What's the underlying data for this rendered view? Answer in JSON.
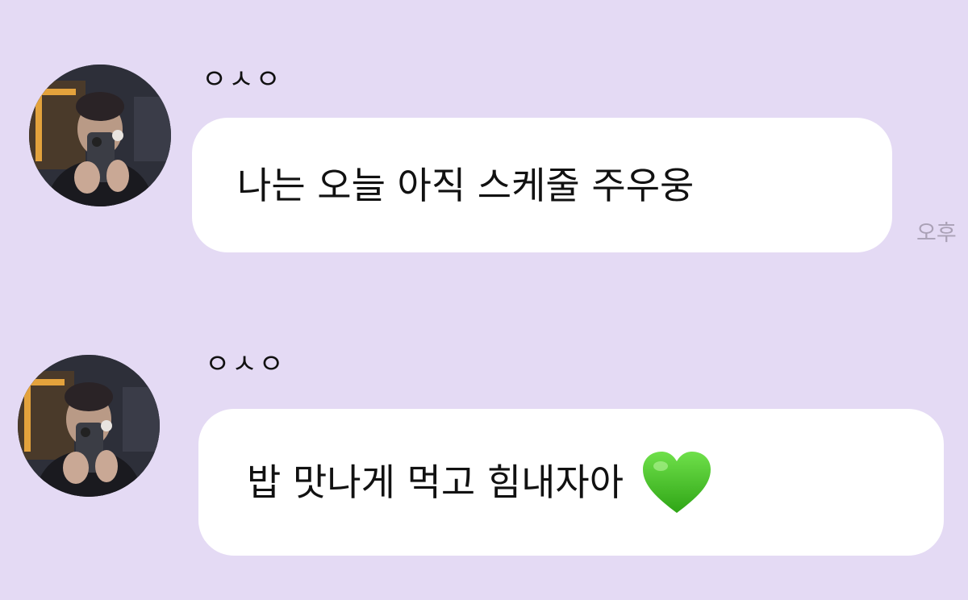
{
  "messages": [
    {
      "sender": "ㅇㅅㅇ",
      "text": "나는 오늘 아직 스케줄 주우웅",
      "timestamp": "오후"
    },
    {
      "sender": "ㅇㅅㅇ",
      "text": "밥 맛나게 먹고 힘내자아",
      "emoji": "green-heart"
    }
  ],
  "colors": {
    "background": "#e4daf4",
    "bubble": "#ffffff",
    "text": "#111111",
    "timestamp": "#aaa1b6",
    "heart": "#3fc21c"
  }
}
